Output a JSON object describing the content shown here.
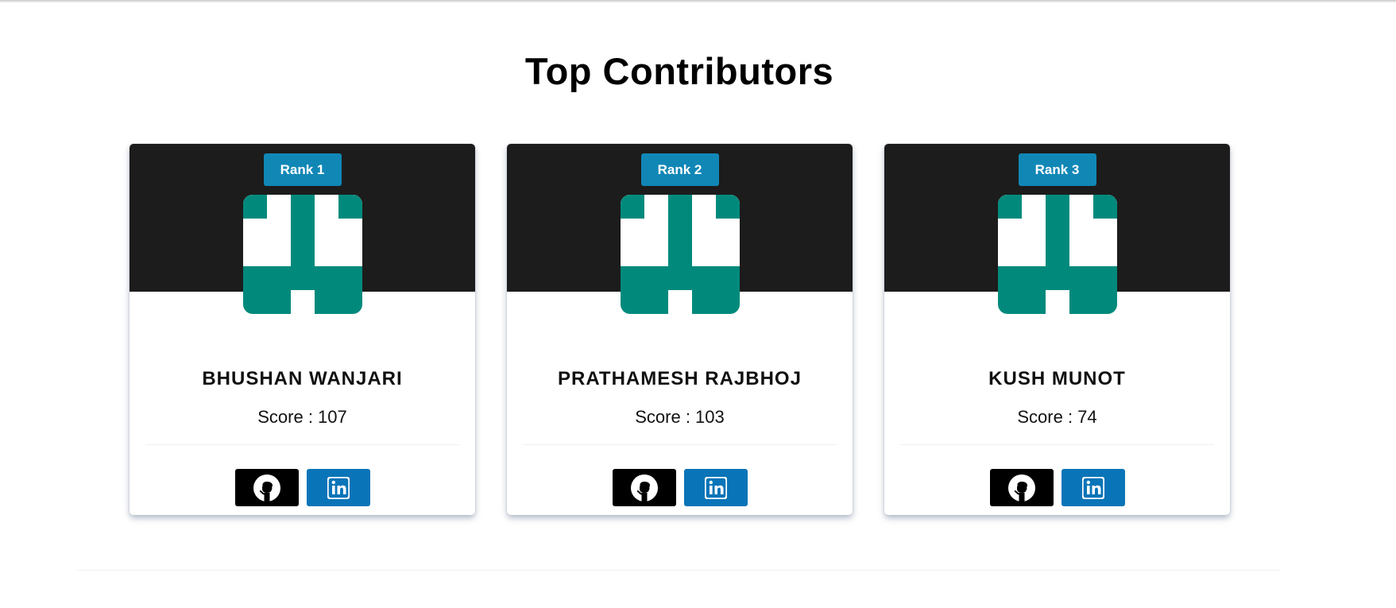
{
  "page": {
    "title": "Top Contributors"
  },
  "colors": {
    "header_bg": "#1c1c1c",
    "rank_badge": "#1187b6",
    "avatar_teal": "#018a7c",
    "github_bg": "#000000",
    "linkedin_bg": "#0a74b8"
  },
  "contributors": [
    {
      "rank": "Rank 1",
      "name": "BHUSHAN WANJARI",
      "score": "Score : 107",
      "github_icon": "github-icon",
      "linkedin_icon": "linkedin-icon"
    },
    {
      "rank": "Rank 2",
      "name": "PRATHAMESH RAJBHOJ",
      "score": "Score : 103",
      "github_icon": "github-icon",
      "linkedin_icon": "linkedin-icon"
    },
    {
      "rank": "Rank 3",
      "name": "KUSH MUNOT",
      "score": "Score : 74",
      "github_icon": "github-icon",
      "linkedin_icon": "linkedin-icon"
    }
  ]
}
